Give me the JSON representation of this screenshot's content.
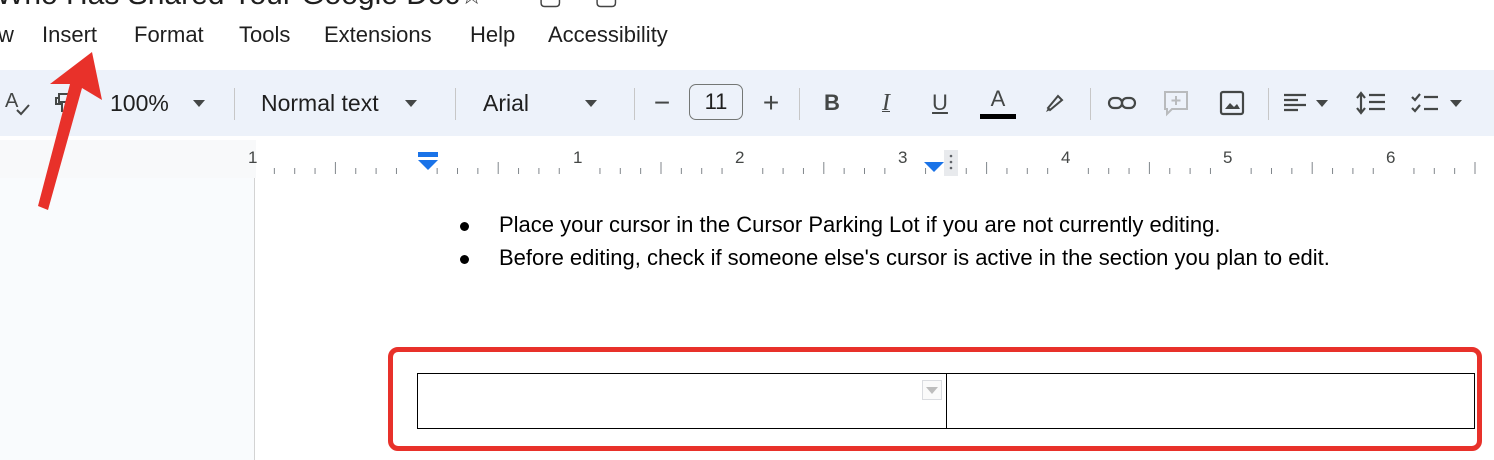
{
  "document": {
    "title": "Who Has Shared Your Google Doc"
  },
  "menu": {
    "items": [
      "w",
      "Insert",
      "Format",
      "Tools",
      "Extensions",
      "Help",
      "Accessibility"
    ]
  },
  "toolbar": {
    "zoom": "100%",
    "style": "Normal text",
    "font": "Arial",
    "font_size": "11",
    "minus": "−",
    "plus": "+",
    "bold": "B",
    "italic": "I",
    "underline": "U",
    "text_color": "A"
  },
  "ruler": {
    "numbers": [
      "1",
      "1",
      "2",
      "3",
      "4",
      "5",
      "6"
    ]
  },
  "content": {
    "bullets": [
      "Place your cursor in the Cursor Parking Lot if you are not currently editing.",
      "Before editing, check if someone else's cursor is active in the section you plan to edit."
    ]
  },
  "colors": {
    "annotation": "#e8312a",
    "toolbar_bg": "#edf2fa",
    "indent_marker": "#1a73e8"
  }
}
